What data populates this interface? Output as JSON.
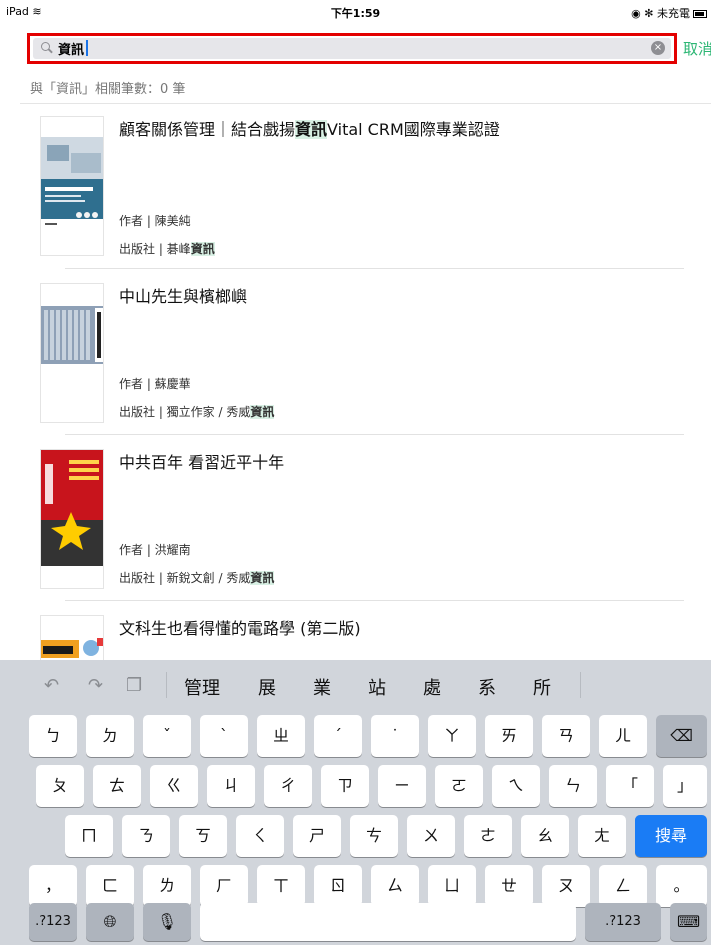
{
  "status_bar": {
    "device": "iPad",
    "time": "下午1:59",
    "right_text": "未充電"
  },
  "search": {
    "query": "資訊",
    "cancel_label": "取消"
  },
  "result_count": "與「資訊」相關筆數：0 筆",
  "books": [
    {
      "title_pre": "顧客關係管理｜結合戲揚",
      "title_hl": "資訊",
      "title_post": "Vital CRM國際專業認證",
      "author": "作者 | 陳美純",
      "publisher_pre": "出版社 | 碁峰",
      "publisher_hl": "資訊",
      "cover_color": "#2f6f8f"
    },
    {
      "title": "中山先生與檳榔嶼",
      "author": "作者 | 蘇慶華",
      "publisher_pre": "出版社 | 獨立作家 / 秀威",
      "publisher_hl": "資訊",
      "cover_color": "#7d8fa6"
    },
    {
      "title": "中共百年 看習近平十年",
      "author": "作者 | 洪耀南",
      "publisher_pre": "出版社 | 新銳文創 / 秀威",
      "publisher_hl": "資訊",
      "cover_color": "#c8141c"
    },
    {
      "title": "文科生也看得懂的電路學 (第二版)",
      "cover_color": "#f0a020"
    }
  ],
  "keyboard": {
    "suggestions": [
      "管理",
      "展",
      "業",
      "站",
      "處",
      "系",
      "所"
    ],
    "row1": [
      "ㄅ",
      "ㄉ",
      "ˇ",
      "ˋ",
      "ㄓ",
      "ˊ",
      "˙",
      "ㄚ",
      "ㄞ",
      "ㄢ",
      "ㄦ"
    ],
    "row2": [
      "ㄆ",
      "ㄊ",
      "ㄍ",
      "ㄐ",
      "ㄔ",
      "ㄗ",
      "ㄧ",
      "ㄛ",
      "ㄟ",
      "ㄣ",
      "「",
      "」"
    ],
    "row3": [
      "ㄇ",
      "ㄋ",
      "ㄎ",
      "ㄑ",
      "ㄕ",
      "ㄘ",
      "ㄨ",
      "ㄜ",
      "ㄠ",
      "ㄤ"
    ],
    "row4": [
      "，",
      "ㄈ",
      "ㄌ",
      "ㄏ",
      "ㄒ",
      "ㄖ",
      "ㄙ",
      "ㄩ",
      "ㄝ",
      "ㄡ",
      "ㄥ",
      "。"
    ],
    "search_label": "搜尋",
    "numbers_label": ".?123",
    "accent": "#1a7cf5"
  }
}
